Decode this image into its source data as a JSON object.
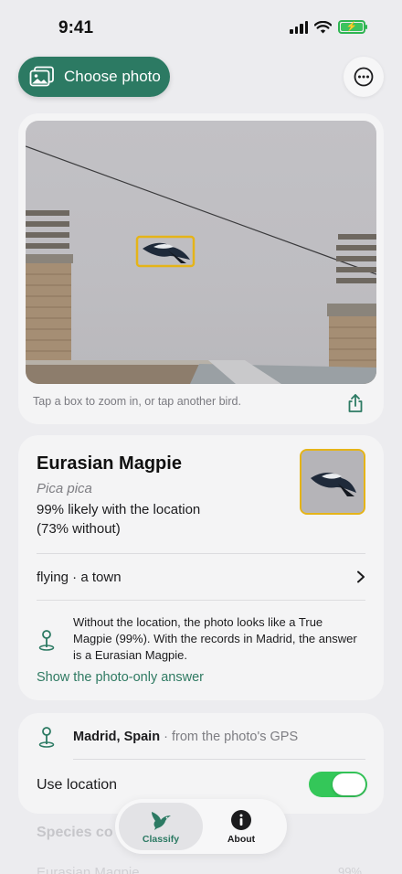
{
  "status_bar": {
    "time": "9:41"
  },
  "toolbar": {
    "choose_photo_label": "Choose photo",
    "more_icon": "ellipsis-circle-icon"
  },
  "photo": {
    "hint": "Tap a box to zoom in, or tap another bird."
  },
  "result": {
    "common_name": "Eurasian Magpie",
    "scientific_name": "Pica pica",
    "likely_with_location": "99% likely with the location",
    "likely_without_location": "(73% without)",
    "behavior": "flying · a town",
    "explanation": "Without the location, the photo looks like a True Magpie (99%). With the records in Madrid, the answer is a Eurasian Magpie.",
    "show_photo_only": "Show the photo-only answer"
  },
  "location": {
    "name": "Madrid, Spain",
    "source": " · from the photo's GPS",
    "use_location_label": "Use location",
    "use_location_enabled": true
  },
  "faded": {
    "section": "Species co",
    "row": "Eurasian Magpie",
    "pct": "99%"
  },
  "tabs": [
    {
      "label": "Classify",
      "icon": "hummingbird-icon",
      "selected": true
    },
    {
      "label": "About",
      "icon": "info-circle-icon",
      "selected": false
    }
  ],
  "colors": {
    "accent": "#2c7a63",
    "highlight": "#e5b418",
    "toggle_on": "#34c759",
    "background": "#ececef"
  }
}
